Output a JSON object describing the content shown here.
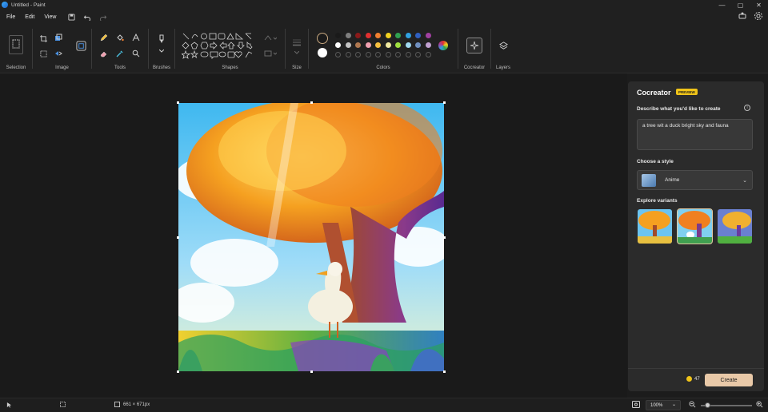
{
  "window": {
    "title": "Untitled - Paint",
    "minimize": "—",
    "maximize": "▢",
    "close": "✕"
  },
  "menu": {
    "items": [
      "File",
      "Edit",
      "View"
    ]
  },
  "ribbon": {
    "groups": {
      "selection": "Selection",
      "image": "Image",
      "tools": "Tools",
      "brushes": "Brushes",
      "shapes": "Shapes",
      "size": "Size",
      "colors": "Colors",
      "cocreator": "Cocreator",
      "layers": "Layers"
    },
    "primary_color": "#1a1a1a",
    "secondary_color": "#ffffff",
    "palette_row1": [
      "#1a1a1a",
      "#7f7f7f",
      "#8b1a1a",
      "#e03030",
      "#f08030",
      "#f0d020",
      "#30a050",
      "#30a0e0",
      "#3060c0",
      "#a040a0"
    ],
    "palette_row2": [
      "#ffffff",
      "#c3c3c3",
      "#b07850",
      "#f0a0b0",
      "#f8c040",
      "#f0e8a0",
      "#a0e040",
      "#a0d8f0",
      "#7090c0",
      "#c0a0d0"
    ]
  },
  "canvas": {
    "size_readout": "661 × 671px"
  },
  "cocreator": {
    "title": "Cocreator",
    "badge": "PREVIEW",
    "describe_label": "Describe what you'd like to create",
    "prompt_value": "a tree wit a duck bright sky and fauna",
    "style_label": "Choose a style",
    "style_value": "Anime",
    "variants_label": "Explore variants",
    "credits": "47",
    "create_label": "Create"
  },
  "status": {
    "zoom": "100%"
  }
}
